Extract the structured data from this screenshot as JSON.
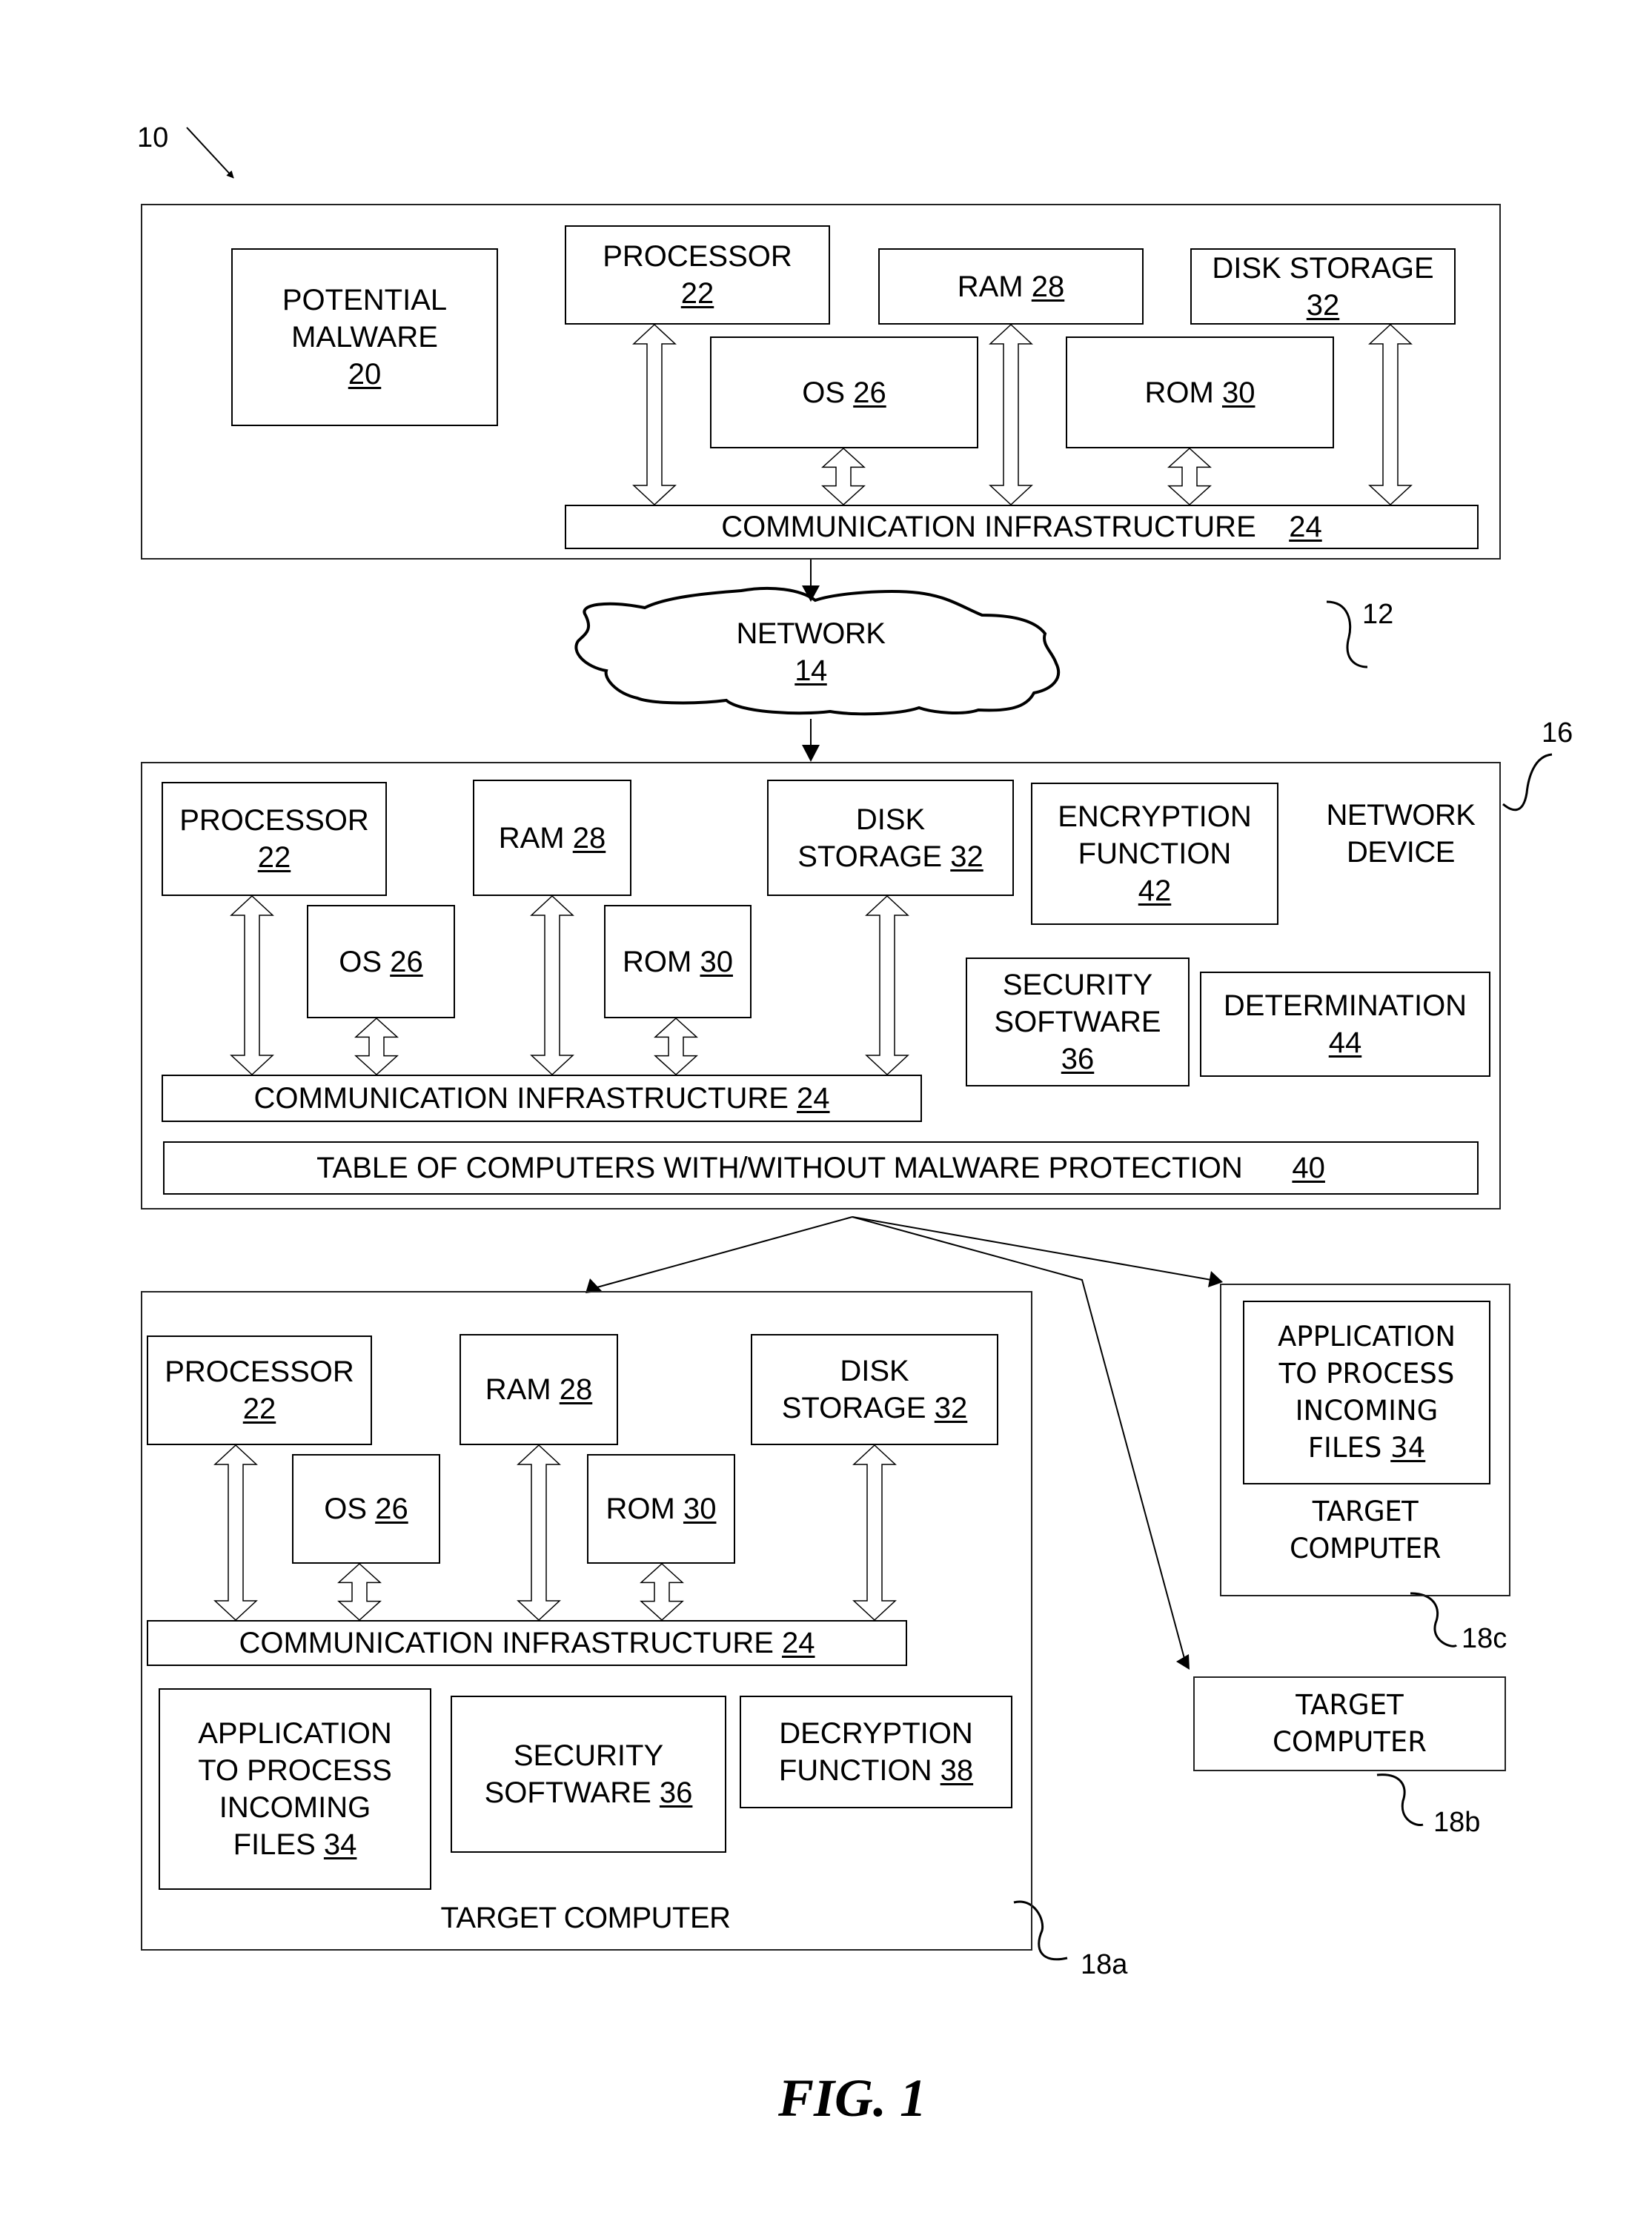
{
  "figure_label": "FIG. 1",
  "ref_labels": {
    "system": "10",
    "source_computer": "12",
    "network_device": "16",
    "target_a": "18a",
    "target_b": "18b",
    "target_c": "18c"
  },
  "source_computer": {
    "malware": {
      "line1": "POTENTIAL",
      "line2": "MALWARE",
      "ref": "20"
    },
    "processor": {
      "label": "PROCESSOR",
      "ref": "22"
    },
    "ram": {
      "label": "RAM",
      "ref": "28"
    },
    "disk": {
      "label": "DISK STORAGE",
      "ref": "32"
    },
    "os": {
      "label": "OS",
      "ref": "26"
    },
    "rom": {
      "label": "ROM",
      "ref": "30"
    },
    "comm": {
      "label": "COMMUNICATION INFRASTRUCTURE",
      "ref": "24"
    }
  },
  "network": {
    "label": "NETWORK",
    "ref": "14"
  },
  "network_device": {
    "title_line1": "NETWORK",
    "title_line2": "DEVICE",
    "processor": {
      "label": "PROCESSOR",
      "ref": "22"
    },
    "ram": {
      "label": "RAM",
      "ref": "28"
    },
    "disk": {
      "line1": "DISK",
      "line2": "STORAGE",
      "ref": "32"
    },
    "os": {
      "label": "OS",
      "ref": "26"
    },
    "rom": {
      "label": "ROM",
      "ref": "30"
    },
    "encryption": {
      "line1": "ENCRYPTION",
      "line2": "FUNCTION",
      "ref": "42"
    },
    "security": {
      "line1": "SECURITY",
      "line2": "SOFTWARE",
      "ref": "36"
    },
    "determination": {
      "label": "DETERMINATION",
      "ref": "44"
    },
    "comm": {
      "label": "COMMUNICATION INFRASTRUCTURE",
      "ref": "24"
    },
    "table": {
      "label": "TABLE OF COMPUTERS WITH/WITHOUT MALWARE PROTECTION",
      "ref": "40"
    }
  },
  "target_a": {
    "title": "TARGET COMPUTER",
    "processor": {
      "label": "PROCESSOR",
      "ref": "22"
    },
    "ram": {
      "label": "RAM",
      "ref": "28"
    },
    "disk": {
      "line1": "DISK",
      "line2": "STORAGE",
      "ref": "32"
    },
    "os": {
      "label": "OS",
      "ref": "26"
    },
    "rom": {
      "label": "ROM",
      "ref": "30"
    },
    "comm": {
      "label": "COMMUNICATION INFRASTRUCTURE",
      "ref": "24"
    },
    "app": {
      "line1": "APPLICATION",
      "line2": "TO PROCESS",
      "line3": "INCOMING",
      "line4": "FILES",
      "ref": "34"
    },
    "security": {
      "line1": "SECURITY",
      "line2": "SOFTWARE",
      "ref": "36"
    },
    "decryption": {
      "line1": "DECRYPTION",
      "line2": "FUNCTION",
      "ref": "38"
    }
  },
  "target_b": {
    "line1": "TARGET",
    "line2": "COMPUTER"
  },
  "target_c": {
    "app": {
      "line1": "APPLICATION",
      "line2": "TO PROCESS",
      "line3": "INCOMING",
      "line4": "FILES",
      "ref": "34"
    },
    "line1": "TARGET",
    "line2": "COMPUTER"
  }
}
